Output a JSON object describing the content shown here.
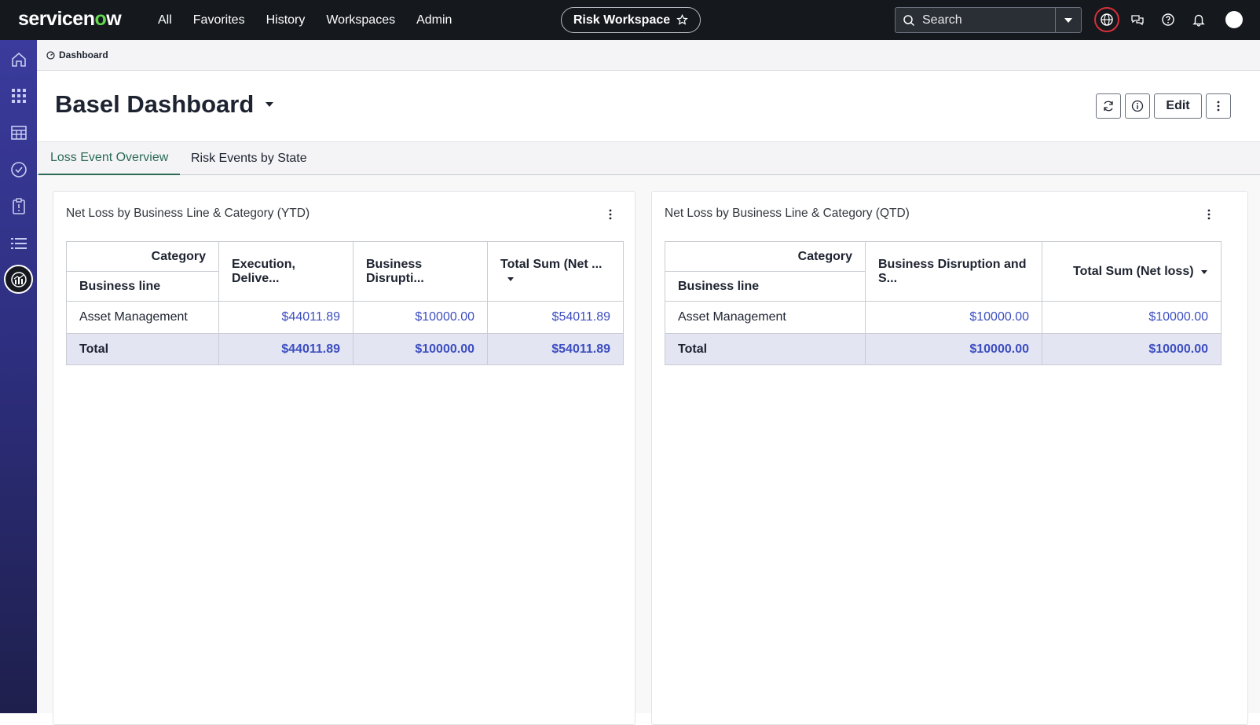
{
  "topbar": {
    "logo_pre": "servicen",
    "logo_o": "o",
    "logo_post": "w",
    "nav": [
      "All",
      "Favorites",
      "History",
      "Workspaces",
      "Admin"
    ],
    "workspace": "Risk Workspace",
    "search_placeholder": "Search"
  },
  "breadcrumb": "Dashboard",
  "header": {
    "title": "Basel Dashboard",
    "edit_label": "Edit"
  },
  "tabs": [
    "Loss Event Overview",
    "Risk Events by State"
  ],
  "cards": [
    {
      "title": "Net Loss by Business Line & Category (YTD)",
      "category_label": "Category",
      "business_line_label": "Business line",
      "columns": [
        "Execution, Delive...",
        "Business Disrupti...",
        "Total Sum (Net ..."
      ],
      "row_label": "Asset Management",
      "row_values": [
        "$44011.89",
        "$10000.00",
        "$54011.89"
      ],
      "total_label": "Total",
      "total_values": [
        "$44011.89",
        "$10000.00",
        "$54011.89"
      ]
    },
    {
      "title": "Net Loss by Business Line & Category (QTD)",
      "category_label": "Category",
      "business_line_label": "Business line",
      "columns": [
        "Business Disruption and S...",
        "Total Sum (Net loss)"
      ],
      "row_label": "Asset Management",
      "row_values": [
        "$10000.00",
        "$10000.00"
      ],
      "total_label": "Total",
      "total_values": [
        "$10000.00",
        "$10000.00"
      ]
    }
  ],
  "colors": {
    "topbar": "#15181d",
    "accent_green": "#62d84e",
    "link_blue": "#3d4ec0",
    "tab_active": "#2b6b55",
    "total_row": "#e3e5f3"
  },
  "icons": [
    "home-icon",
    "apps-grid-icon",
    "table-icon",
    "check-circle-icon",
    "clipboard-icon",
    "list-icon",
    "analytics-icon",
    "globe-icon",
    "chat-icon",
    "help-icon",
    "bell-icon",
    "star-icon",
    "search-icon",
    "refresh-icon",
    "info-icon",
    "more-vertical-icon"
  ]
}
